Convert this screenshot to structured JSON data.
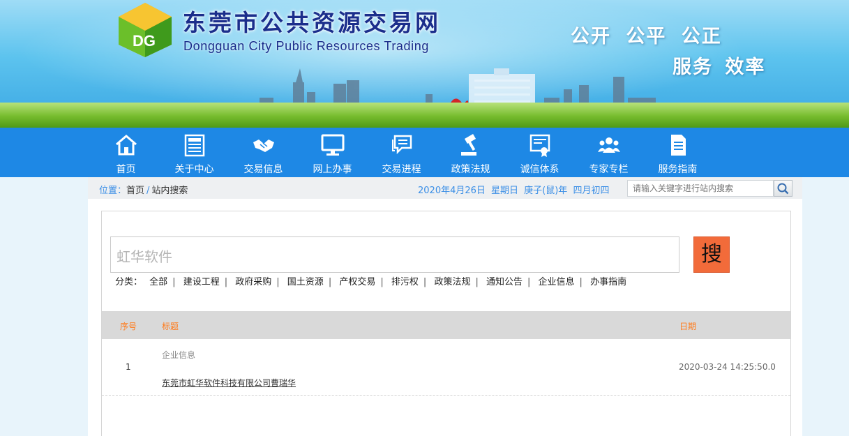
{
  "header": {
    "title": "东莞市公共资源交易网",
    "subtitle": "Dongguan City Public Resources Trading",
    "slogan_line1": "公开 公平 公正",
    "slogan_line2": "服务 效率"
  },
  "nav": {
    "items": [
      {
        "label": "首页",
        "icon": "home-icon"
      },
      {
        "label": "关于中心",
        "icon": "news-icon"
      },
      {
        "label": "交易信息",
        "icon": "handshake-icon"
      },
      {
        "label": "网上办事",
        "icon": "monitor-icon"
      },
      {
        "label": "交易进程",
        "icon": "chat-bubbles-icon"
      },
      {
        "label": "政策法规",
        "icon": "gavel-icon"
      },
      {
        "label": "诚信体系",
        "icon": "certificate-icon"
      },
      {
        "label": "专家专栏",
        "icon": "people-icon"
      },
      {
        "label": "服务指南",
        "icon": "document-icon"
      }
    ]
  },
  "breadcrumb": {
    "prefix": "位置：",
    "home": "首页",
    "separator": "/",
    "current": "站内搜索"
  },
  "date_text": "2020年4月26日 星期日 庚子(鼠)年 四月初四",
  "top_search": {
    "placeholder": "请输入关键字进行站内搜索"
  },
  "search": {
    "value": "虹华软件",
    "button_label": "搜"
  },
  "categories": {
    "label": "分类：",
    "items": [
      "全部",
      "建设工程",
      "政府采购",
      "国土资源",
      "产权交易",
      "排污权",
      "政策法规",
      "通知公告",
      "企业信息",
      "办事指南"
    ]
  },
  "table": {
    "headers": {
      "no": "序号",
      "title": "标题",
      "date": "日期"
    },
    "rows": [
      {
        "no": "1",
        "category": "企业信息",
        "title": "东莞市虹华软件科技有限公司曹瑞华",
        "date": "2020-03-24 14:25:50.0"
      }
    ]
  },
  "colors": {
    "nav_blue": "#1e88e5",
    "search_button": "#f26b3a",
    "header_text_orange": "#ff7a1a",
    "link_blue": "#3a8ee6"
  }
}
